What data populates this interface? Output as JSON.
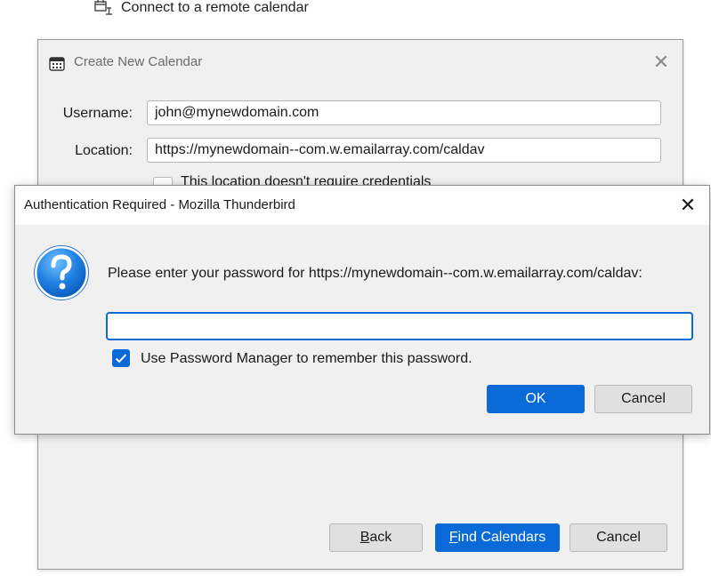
{
  "top_option": {
    "label": "Connect to a remote calendar",
    "icon": "network-calendar-icon"
  },
  "create_dialog": {
    "title": "Create New Calendar",
    "title_icon": "calendar-icon",
    "username_label": "Username:",
    "username_value": "john@mynewdomain.com",
    "location_label": "Location:",
    "location_value": "https://mynewdomain--com.w.emailarray.com/caldav",
    "no_credentials_label": "This location doesn't require credentials",
    "no_credentials_checked": false,
    "buttons": {
      "back": "Back",
      "find": "Find Calendars",
      "cancel": "Cancel"
    }
  },
  "auth_dialog": {
    "title": "Authentication Required - Mozilla Thunderbird",
    "message": "Please enter your password for https://mynewdomain--com.w.emailarray.com/caldav:",
    "password_value": "",
    "remember_label": "Use Password Manager to remember this password.",
    "remember_checked": true,
    "buttons": {
      "ok": "OK",
      "cancel": "Cancel"
    },
    "icon": "question-icon"
  },
  "colors": {
    "accent": "#0a6bd8",
    "dialog_bg": "#f0f0f0",
    "titlebar_bg": "#ffffff"
  }
}
